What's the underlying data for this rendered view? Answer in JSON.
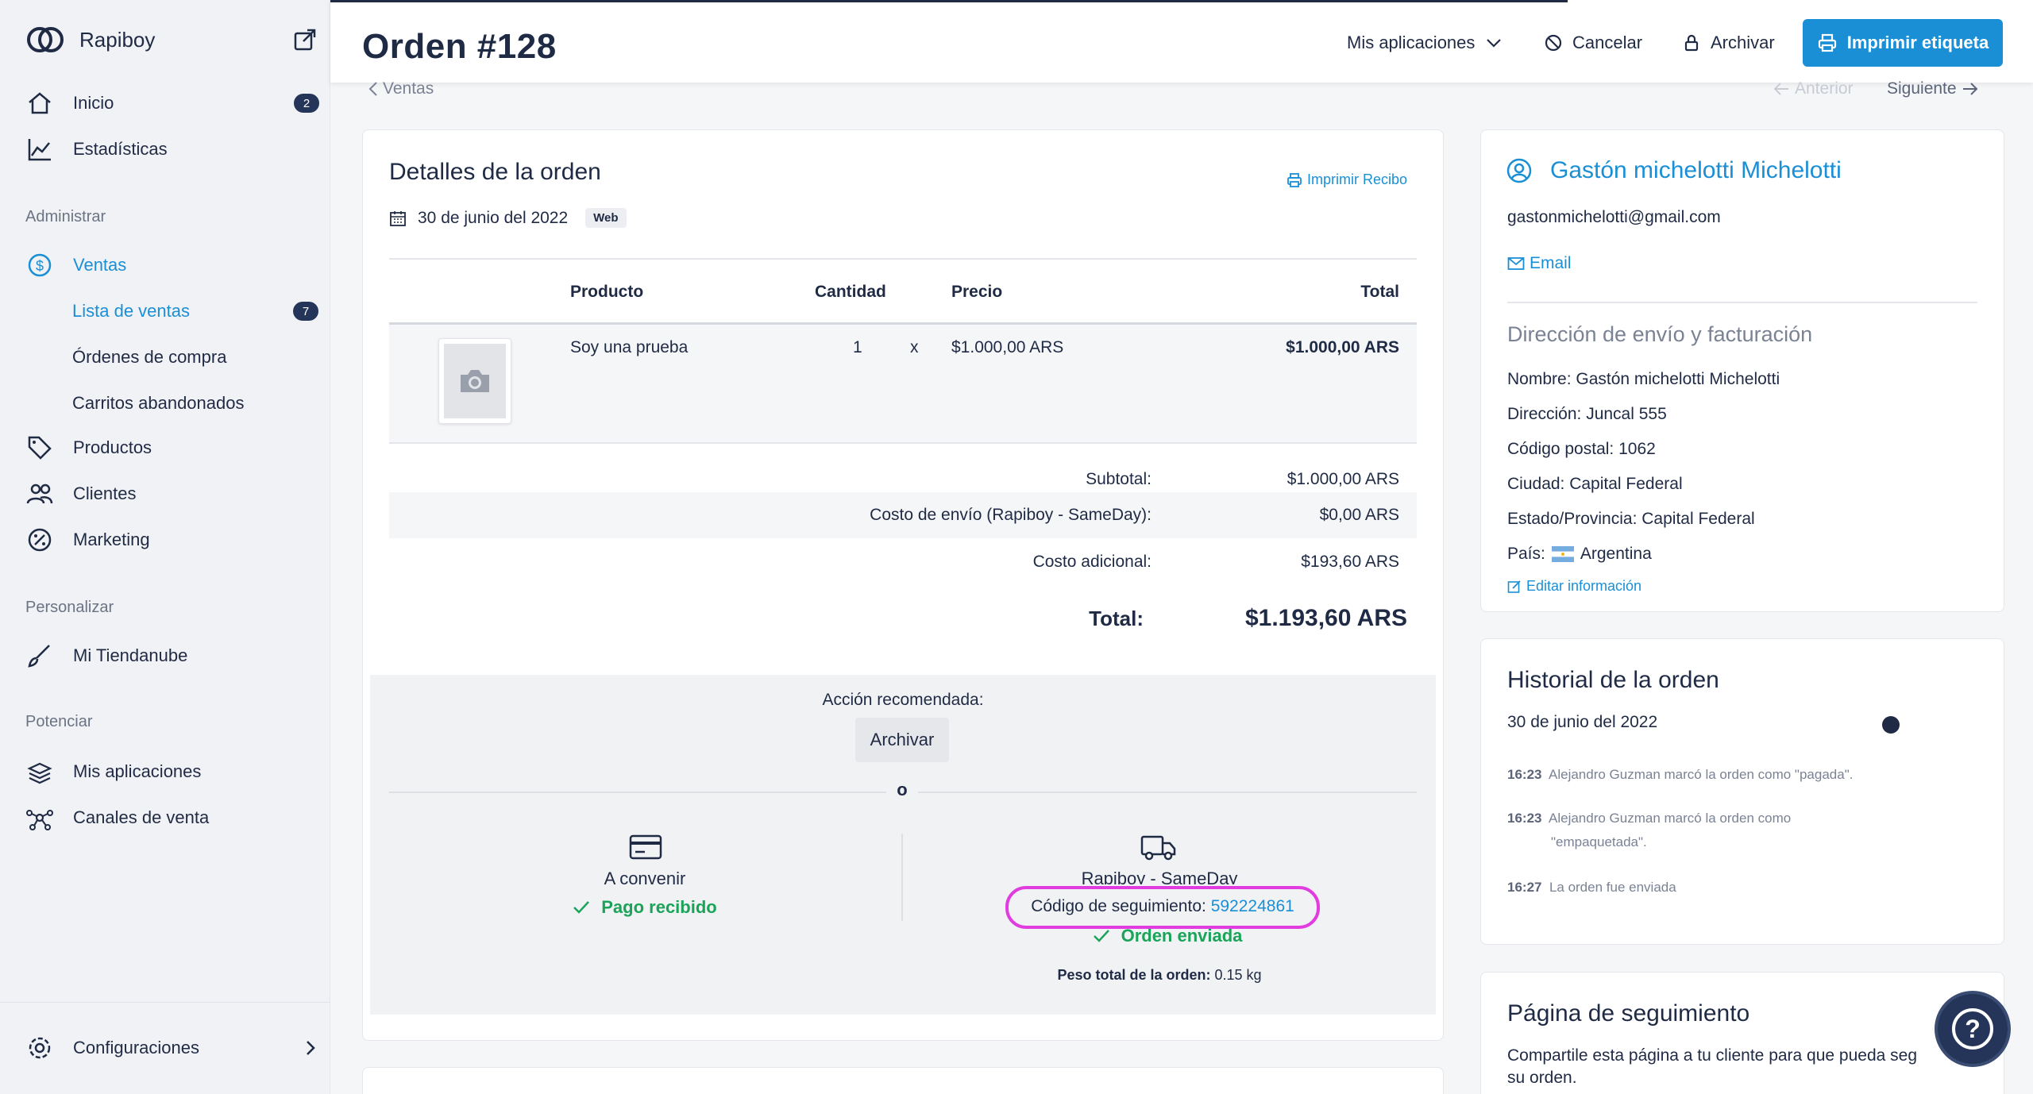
{
  "sidebar": {
    "brand": "Rapiboy",
    "items": [
      {
        "label": "Inicio",
        "badge": "2"
      },
      {
        "label": "Estadísticas"
      }
    ],
    "section_admin": "Administrar",
    "ventas": "Ventas",
    "sub": [
      {
        "label": "Lista de ventas",
        "badge": "7"
      },
      {
        "label": "Órdenes de compra"
      },
      {
        "label": "Carritos abandonados"
      }
    ],
    "productos": "Productos",
    "clientes": "Clientes",
    "marketing": "Marketing",
    "section_personalizar": "Personalizar",
    "mi_tiendanube": "Mi Tiendanube",
    "section_potenciar": "Potenciar",
    "mis_aplicaciones": "Mis aplicaciones",
    "canales": "Canales de venta",
    "configuraciones": "Configuraciones"
  },
  "header": {
    "title": "Orden #128",
    "apps": "Mis aplicaciones",
    "cancel": "Cancelar",
    "archive": "Archivar",
    "print_label": "Imprimir etiqueta"
  },
  "nav": {
    "back": "Ventas",
    "prev": "Anterior",
    "next": "Siguiente"
  },
  "order": {
    "title": "Detalles de la orden",
    "print_receipt": "Imprimir Recibo",
    "date": "30 de junio del 2022",
    "channel": "Web",
    "columns": {
      "product": "Producto",
      "qty": "Cantidad",
      "price": "Precio",
      "total": "Total"
    },
    "line": {
      "name": "Soy una prueba",
      "qty": "1",
      "x": "x",
      "price": "$1.000,00 ARS",
      "total": "$1.000,00 ARS"
    },
    "subtotal_label": "Subtotal:",
    "subtotal": "$1.000,00 ARS",
    "shipping_label": "Costo de envío (Rapiboy - SameDay):",
    "shipping": "$0,00 ARS",
    "extra_label": "Costo adicional:",
    "extra": "$193,60 ARS",
    "total_label": "Total:",
    "total": "$1.193,60 ARS",
    "recommended": "Acción recomendada:",
    "archive_btn": "Archivar",
    "or": "o",
    "payment_method": "A convenir",
    "payment_status": "Pago recibido",
    "shipping_method": "Rapiboy - SameDay",
    "tracking_label": "Código de seguimiento:",
    "tracking_code": "592224861",
    "shipping_status": "Orden enviada",
    "weight_label": "Peso total de la orden:",
    "weight": "0.15 kg"
  },
  "customer": {
    "name": "Gastón michelotti Michelotti",
    "email": "gastonmichelotti@gmail.com",
    "email_link": "Email",
    "address_title": "Dirección de envío y facturación",
    "lines": [
      "Nombre: Gastón michelotti Michelotti",
      "Dirección: Juncal 555",
      "Código postal: 1062",
      "Ciudad: Capital Federal",
      "Estado/Provincia: Capital Federal"
    ],
    "country_label": "País:",
    "country": "Argentina",
    "edit": "Editar información"
  },
  "history": {
    "title": "Historial de la orden",
    "date": "30 de junio del 2022",
    "entries": [
      {
        "time": "16:23",
        "text": "Alejandro Guzman marcó la orden como \"pagada\"."
      },
      {
        "time": "16:23",
        "text": "Alejandro Guzman marcó la orden como",
        "text2": "\"empaquetada\"."
      },
      {
        "time": "16:27",
        "text": "La orden fue enviada"
      }
    ]
  },
  "tracking_page": {
    "title": "Página de seguimiento",
    "text1": "Compartile esta página a tu cliente para que pueda seg",
    "text2": "su orden."
  },
  "help": "?",
  "colors": {
    "accent": "#1a8fd6",
    "dark": "#1f2a44",
    "success": "#1ba35a",
    "highlight": "#e03ce0"
  }
}
